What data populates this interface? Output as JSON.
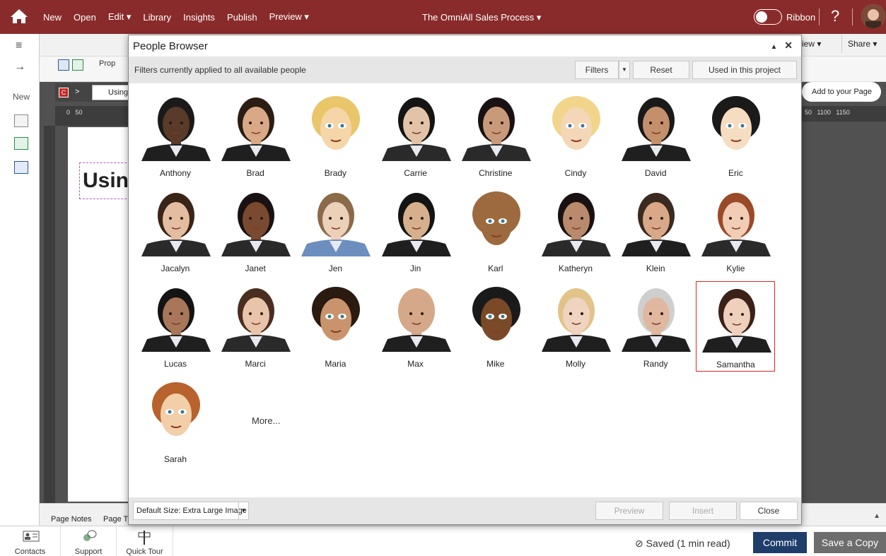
{
  "topbar": {
    "menu": [
      "New",
      "Open",
      "Edit ▾",
      "Library",
      "Insights",
      "Publish",
      "Preview ▾"
    ],
    "project_title": "The OmniAll Sales Process ▾",
    "ribbon_label": "Ribbon",
    "help_label": "?"
  },
  "leftbar": {
    "new_label": "New"
  },
  "toolbar": {
    "prop_label": "Prop",
    "view_label": "iew ▾",
    "share_label": "Share ▾",
    "add_to_page": "Add to your Page",
    "using_tab": "Using",
    "using_title": "Usin",
    "ruler_numbers": "0   50",
    "ruler_right": "50   1100   1150"
  },
  "dialog": {
    "title": "People Browser",
    "collapse_icon": "▲",
    "close_icon": "✕",
    "filter_text": "Filters currently applied to all available people",
    "filters_btn": "Filters",
    "reset_btn": "Reset",
    "used_btn": "Used in this project",
    "people": [
      {
        "name": "Anthony",
        "skin": "#5a3a28",
        "hair": "#1a1a1a",
        "suit": "#1f1f1f",
        "cartoon": false
      },
      {
        "name": "Brad",
        "skin": "#d9a987",
        "hair": "#2b1d14",
        "suit": "#1f1f1f",
        "cartoon": false
      },
      {
        "name": "Brady",
        "skin": "#f4d6a8",
        "hair": "#e9c66a",
        "suit": "#e9d9b8",
        "cartoon": true
      },
      {
        "name": "Carrie",
        "skin": "#e3c3a8",
        "hair": "#141414",
        "suit": "#2a2a2a",
        "cartoon": false
      },
      {
        "name": "Christine",
        "skin": "#c99a7a",
        "hair": "#1a1212",
        "suit": "#2a2a2a",
        "cartoon": false
      },
      {
        "name": "Cindy",
        "skin": "#f3d7b6",
        "hair": "#f1d58a",
        "suit": "#f3d7b6",
        "cartoon": true
      },
      {
        "name": "David",
        "skin": "#c4906c",
        "hair": "#1a1a1a",
        "suit": "#1f1f1f",
        "cartoon": false
      },
      {
        "name": "Eric",
        "skin": "#f6dcc0",
        "hair": "#1a1a1a",
        "suit": "#f6dcc0",
        "cartoon": true
      },
      {
        "name": "Jacalyn",
        "skin": "#e4bda0",
        "hair": "#3a2418",
        "suit": "#2a2a2a",
        "cartoon": false
      },
      {
        "name": "Janet",
        "skin": "#7a4a30",
        "hair": "#1a1212",
        "suit": "#2a2a2a",
        "cartoon": false
      },
      {
        "name": "Jen",
        "skin": "#edd0b8",
        "hair": "#8a6a48",
        "suit": "#6c8fbf",
        "cartoon": false
      },
      {
        "name": "Jin",
        "skin": "#d6b08c",
        "hair": "#141414",
        "suit": "#1f1f1f",
        "cartoon": false
      },
      {
        "name": "Karl",
        "skin": "#9c6a3e",
        "hair": "#9c6a3e",
        "suit": "#9c6a3e",
        "cartoon": true
      },
      {
        "name": "Katheryn",
        "skin": "#b98a6c",
        "hair": "#1a1212",
        "suit": "#2a2a2a",
        "cartoon": false
      },
      {
        "name": "Klein",
        "skin": "#d8a888",
        "hair": "#3a2a20",
        "suit": "#1f1f1f",
        "cartoon": false
      },
      {
        "name": "Kylie",
        "skin": "#f0cdb4",
        "hair": "#9a4a28",
        "suit": "#2a2a2a",
        "cartoon": false
      },
      {
        "name": "Lucas",
        "skin": "#a87658",
        "hair": "#141414",
        "suit": "#1f1f1f",
        "cartoon": false
      },
      {
        "name": "Marci",
        "skin": "#e8c4aa",
        "hair": "#4a2e20",
        "suit": "#2a2a2a",
        "cartoon": false
      },
      {
        "name": "Maria",
        "skin": "#c9946c",
        "hair": "#2a1a10",
        "suit": "#c9946c",
        "cartoon": true
      },
      {
        "name": "Max",
        "skin": "#d4a888",
        "hair": "#d4a888",
        "suit": "#1f1f1f",
        "cartoon": false
      },
      {
        "name": "Mike",
        "skin": "#7a4a28",
        "hair": "#1a1a1a",
        "suit": "#7a4a28",
        "cartoon": true
      },
      {
        "name": "Molly",
        "skin": "#f0d4c0",
        "hair": "#e2c48a",
        "suit": "#1f1f1f",
        "cartoon": false
      },
      {
        "name": "Randy",
        "skin": "#e0b8a0",
        "hair": "#cfcfcf",
        "suit": "#1f1f1f",
        "cartoon": false
      },
      {
        "name": "Samantha",
        "skin": "#eed0bc",
        "hair": "#3a2218",
        "suit": "#1f1f1f",
        "cartoon": false
      },
      {
        "name": "Sarah",
        "skin": "#f2cfa8",
        "hair": "#b8622e",
        "suit": "#f2cfa8",
        "cartoon": true
      }
    ],
    "selected": "Samantha",
    "more_label": "More...",
    "default_size": "Default Size: Extra Large Image",
    "preview_btn": "Preview",
    "insert_btn": "Insert",
    "close_btn": "Close"
  },
  "pagebar": {
    "page_notes": "Page Notes",
    "page_t": "Page T"
  },
  "status": {
    "contacts": "Contacts",
    "support": "Support",
    "quick_tour": "Quick Tour",
    "saved": "Saved (1 min read)",
    "commit": "Commit",
    "save_copy": "Save a Copy"
  },
  "colors": {
    "topbar": "#8a2b2b",
    "commit": "#1f3d6b",
    "selected_border": "#e0262a"
  }
}
